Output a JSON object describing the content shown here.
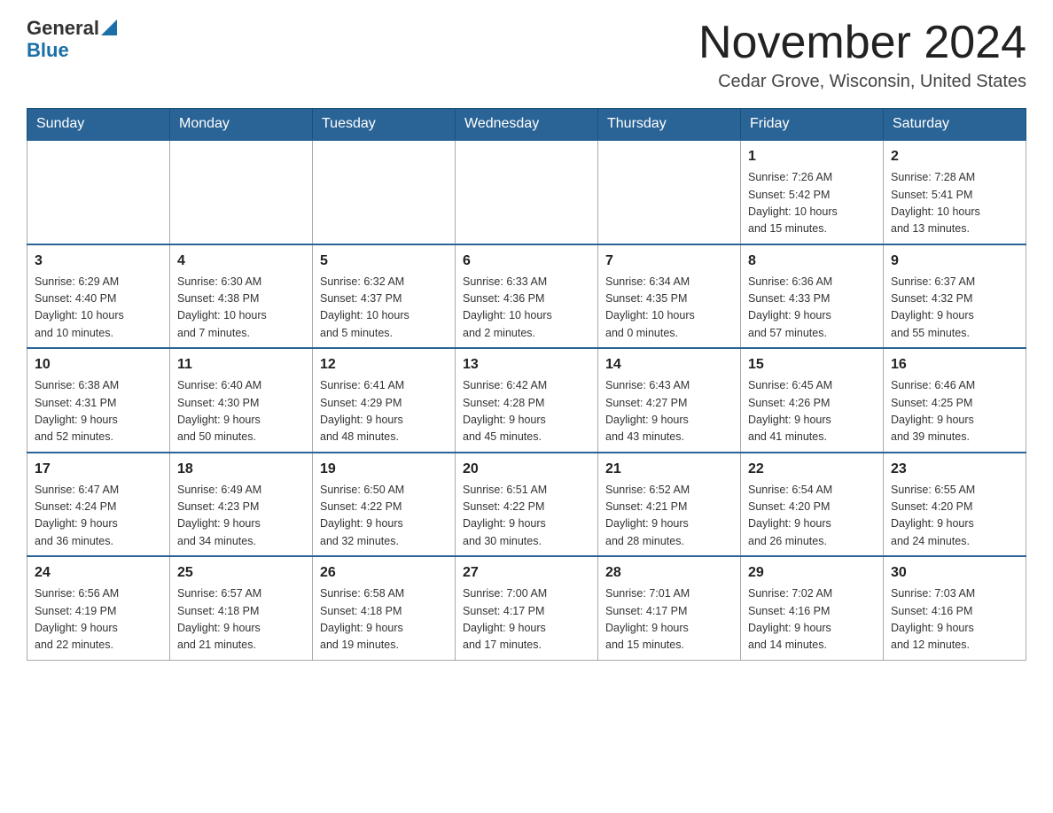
{
  "header": {
    "logo": {
      "general": "General",
      "blue": "Blue",
      "triangle_color": "#1a6fa8"
    },
    "title": "November 2024",
    "subtitle": "Cedar Grove, Wisconsin, United States"
  },
  "calendar": {
    "days_of_week": [
      "Sunday",
      "Monday",
      "Tuesday",
      "Wednesday",
      "Thursday",
      "Friday",
      "Saturday"
    ],
    "weeks": [
      {
        "days": [
          {
            "date": "",
            "info": ""
          },
          {
            "date": "",
            "info": ""
          },
          {
            "date": "",
            "info": ""
          },
          {
            "date": "",
            "info": ""
          },
          {
            "date": "",
            "info": ""
          },
          {
            "date": "1",
            "info": "Sunrise: 7:26 AM\nSunset: 5:42 PM\nDaylight: 10 hours\nand 15 minutes."
          },
          {
            "date": "2",
            "info": "Sunrise: 7:28 AM\nSunset: 5:41 PM\nDaylight: 10 hours\nand 13 minutes."
          }
        ]
      },
      {
        "days": [
          {
            "date": "3",
            "info": "Sunrise: 6:29 AM\nSunset: 4:40 PM\nDaylight: 10 hours\nand 10 minutes."
          },
          {
            "date": "4",
            "info": "Sunrise: 6:30 AM\nSunset: 4:38 PM\nDaylight: 10 hours\nand 7 minutes."
          },
          {
            "date": "5",
            "info": "Sunrise: 6:32 AM\nSunset: 4:37 PM\nDaylight: 10 hours\nand 5 minutes."
          },
          {
            "date": "6",
            "info": "Sunrise: 6:33 AM\nSunset: 4:36 PM\nDaylight: 10 hours\nand 2 minutes."
          },
          {
            "date": "7",
            "info": "Sunrise: 6:34 AM\nSunset: 4:35 PM\nDaylight: 10 hours\nand 0 minutes."
          },
          {
            "date": "8",
            "info": "Sunrise: 6:36 AM\nSunset: 4:33 PM\nDaylight: 9 hours\nand 57 minutes."
          },
          {
            "date": "9",
            "info": "Sunrise: 6:37 AM\nSunset: 4:32 PM\nDaylight: 9 hours\nand 55 minutes."
          }
        ]
      },
      {
        "days": [
          {
            "date": "10",
            "info": "Sunrise: 6:38 AM\nSunset: 4:31 PM\nDaylight: 9 hours\nand 52 minutes."
          },
          {
            "date": "11",
            "info": "Sunrise: 6:40 AM\nSunset: 4:30 PM\nDaylight: 9 hours\nand 50 minutes."
          },
          {
            "date": "12",
            "info": "Sunrise: 6:41 AM\nSunset: 4:29 PM\nDaylight: 9 hours\nand 48 minutes."
          },
          {
            "date": "13",
            "info": "Sunrise: 6:42 AM\nSunset: 4:28 PM\nDaylight: 9 hours\nand 45 minutes."
          },
          {
            "date": "14",
            "info": "Sunrise: 6:43 AM\nSunset: 4:27 PM\nDaylight: 9 hours\nand 43 minutes."
          },
          {
            "date": "15",
            "info": "Sunrise: 6:45 AM\nSunset: 4:26 PM\nDaylight: 9 hours\nand 41 minutes."
          },
          {
            "date": "16",
            "info": "Sunrise: 6:46 AM\nSunset: 4:25 PM\nDaylight: 9 hours\nand 39 minutes."
          }
        ]
      },
      {
        "days": [
          {
            "date": "17",
            "info": "Sunrise: 6:47 AM\nSunset: 4:24 PM\nDaylight: 9 hours\nand 36 minutes."
          },
          {
            "date": "18",
            "info": "Sunrise: 6:49 AM\nSunset: 4:23 PM\nDaylight: 9 hours\nand 34 minutes."
          },
          {
            "date": "19",
            "info": "Sunrise: 6:50 AM\nSunset: 4:22 PM\nDaylight: 9 hours\nand 32 minutes."
          },
          {
            "date": "20",
            "info": "Sunrise: 6:51 AM\nSunset: 4:22 PM\nDaylight: 9 hours\nand 30 minutes."
          },
          {
            "date": "21",
            "info": "Sunrise: 6:52 AM\nSunset: 4:21 PM\nDaylight: 9 hours\nand 28 minutes."
          },
          {
            "date": "22",
            "info": "Sunrise: 6:54 AM\nSunset: 4:20 PM\nDaylight: 9 hours\nand 26 minutes."
          },
          {
            "date": "23",
            "info": "Sunrise: 6:55 AM\nSunset: 4:20 PM\nDaylight: 9 hours\nand 24 minutes."
          }
        ]
      },
      {
        "days": [
          {
            "date": "24",
            "info": "Sunrise: 6:56 AM\nSunset: 4:19 PM\nDaylight: 9 hours\nand 22 minutes."
          },
          {
            "date": "25",
            "info": "Sunrise: 6:57 AM\nSunset: 4:18 PM\nDaylight: 9 hours\nand 21 minutes."
          },
          {
            "date": "26",
            "info": "Sunrise: 6:58 AM\nSunset: 4:18 PM\nDaylight: 9 hours\nand 19 minutes."
          },
          {
            "date": "27",
            "info": "Sunrise: 7:00 AM\nSunset: 4:17 PM\nDaylight: 9 hours\nand 17 minutes."
          },
          {
            "date": "28",
            "info": "Sunrise: 7:01 AM\nSunset: 4:17 PM\nDaylight: 9 hours\nand 15 minutes."
          },
          {
            "date": "29",
            "info": "Sunrise: 7:02 AM\nSunset: 4:16 PM\nDaylight: 9 hours\nand 14 minutes."
          },
          {
            "date": "30",
            "info": "Sunrise: 7:03 AM\nSunset: 4:16 PM\nDaylight: 9 hours\nand 12 minutes."
          }
        ]
      }
    ]
  }
}
